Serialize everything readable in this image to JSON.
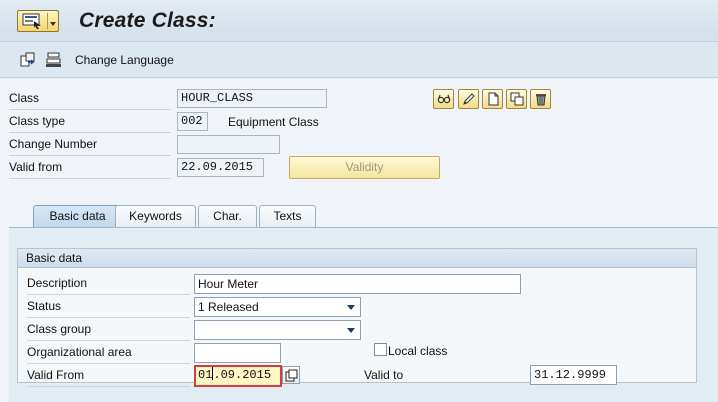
{
  "window": {
    "title": "Create Class:"
  },
  "toolbar": {
    "change_language_label": "Change Language"
  },
  "header_fields": {
    "class_label": "Class",
    "class_value": "HOUR_CLASS",
    "class_type_label": "Class type",
    "class_type_value": "002",
    "class_type_desc": "Equipment Class",
    "change_number_label": "Change Number",
    "change_number_value": "",
    "valid_from_label": "Valid from",
    "valid_from_value": "22.09.2015",
    "validity_button_label": "Validity"
  },
  "tabs": [
    {
      "label": "Basic data",
      "active": true
    },
    {
      "label": "Keywords",
      "active": false
    },
    {
      "label": "Char.",
      "active": false
    },
    {
      "label": "Texts",
      "active": false
    }
  ],
  "basic_data": {
    "group_title": "Basic data",
    "description_label": "Description",
    "description_value": "Hour Meter",
    "status_label": "Status",
    "status_value": "1 Released",
    "class_group_label": "Class group",
    "class_group_value": "",
    "org_area_label": "Organizational area",
    "org_area_value": "",
    "local_class_label": "Local class",
    "local_class_checked": false,
    "valid_from_label": "Valid From",
    "valid_from_value_before_cursor": "01",
    "valid_from_value_after_cursor": ".09.2015",
    "valid_to_label": "Valid to",
    "valid_to_value": "31.12.9999"
  },
  "icons": {
    "menu": "sap-menu-icon",
    "other_object": "other-object-icon",
    "hierarchy": "class-hierarchy-icon",
    "display_change": "display-change-icon",
    "create": "create-icon",
    "copy": "copy-icon",
    "delete": "delete-icon",
    "calendar": "calendar-picker-icon"
  },
  "colors": {
    "focus_border": "#d04040",
    "focus_bg": "#fff6c6",
    "button_gold": "#f3d66d"
  }
}
